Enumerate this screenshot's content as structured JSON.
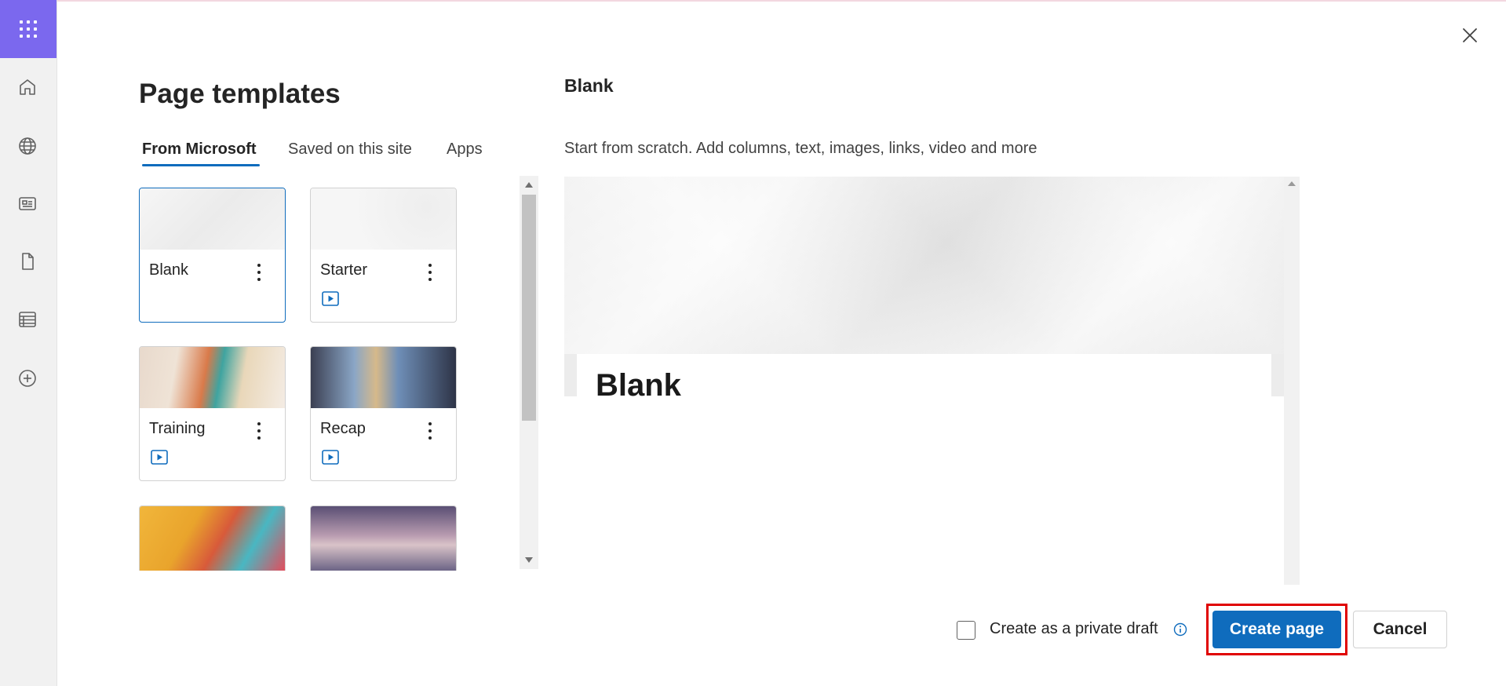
{
  "dialog": {
    "title": "Page templates",
    "close_label": "close"
  },
  "tabs": [
    {
      "label": "From Microsoft",
      "active": true
    },
    {
      "label": "Saved on this site",
      "active": false
    },
    {
      "label": "Apps",
      "active": false
    }
  ],
  "templates": [
    {
      "name": "Blank",
      "selected": true,
      "video": false
    },
    {
      "name": "Starter",
      "selected": false,
      "video": true
    },
    {
      "name": "Training",
      "selected": false,
      "video": true
    },
    {
      "name": "Recap",
      "selected": false,
      "video": true
    }
  ],
  "preview": {
    "heading": "Blank",
    "description": "Start from scratch. Add columns, text, images, links, video and more",
    "page_title": "Blank"
  },
  "footer": {
    "private_draft_label": "Create as a private draft",
    "private_draft_checked": false,
    "create_label": "Create page",
    "cancel_label": "Cancel"
  },
  "colors": {
    "accent": "#0f6cbd",
    "waffle": "#7b68ee",
    "highlight": "#e00000"
  },
  "rail_icons": [
    "app-launcher-icon",
    "home-icon",
    "globe-icon",
    "news-icon",
    "document-icon",
    "list-icon",
    "add-icon"
  ]
}
